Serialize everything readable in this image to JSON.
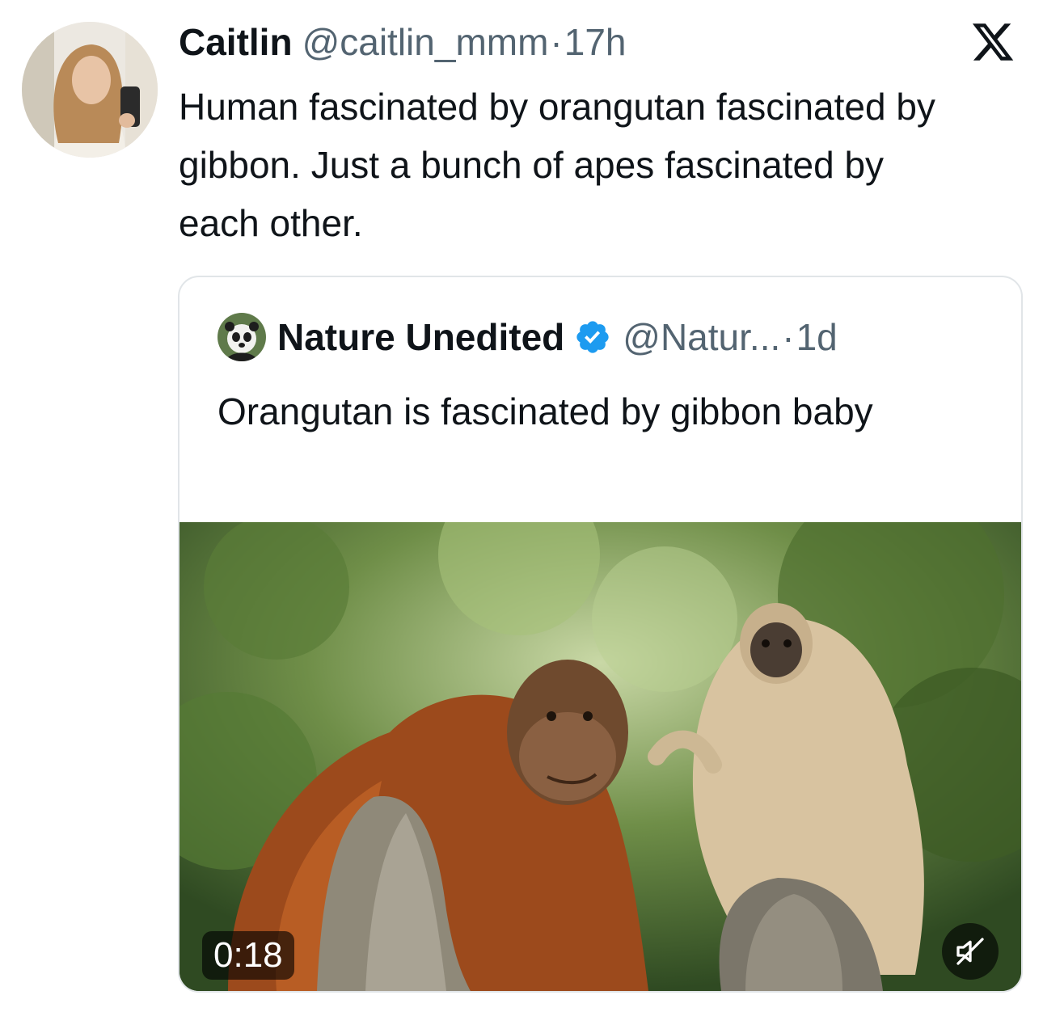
{
  "tweet": {
    "author_name": "Caitlin",
    "handle": "@caitlin_mmm",
    "separator": "·",
    "time": "17h",
    "text": "Human fascinated by orangutan fascinated by gibbon. Just a bunch of apes fascinated by each other.",
    "platform_icon": "x-logo-icon"
  },
  "quote": {
    "author_name": "Nature Unedited",
    "verified_icon": "verified-badge-icon",
    "handle": "@Natur...",
    "separator": "·",
    "time": "1d",
    "text": "Orangutan is fascinated by gibbon baby",
    "video": {
      "duration": "0:18",
      "mute_icon": "muted-speaker-icon"
    }
  },
  "colors": {
    "primary_text": "#0f1419",
    "secondary_text": "#536471",
    "verified_blue": "#1d9bf0",
    "card_border": "#e1e5e8"
  }
}
